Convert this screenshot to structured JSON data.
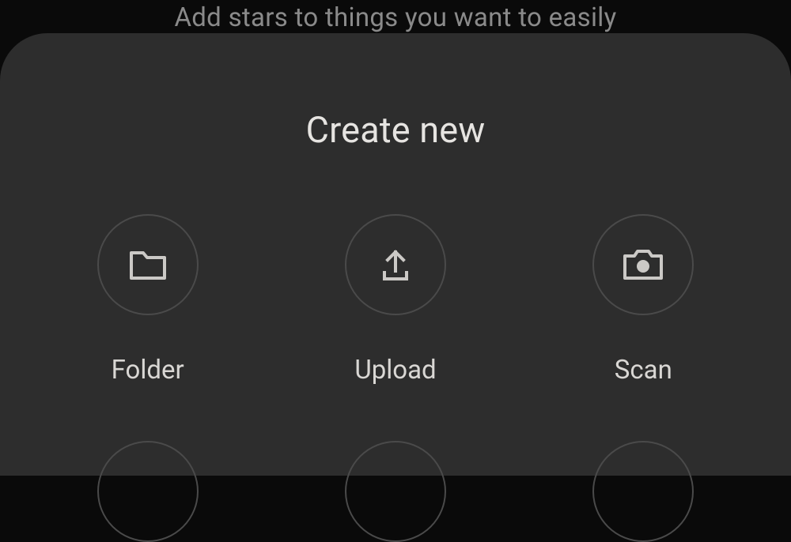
{
  "backdrop": {
    "hint_line": "Add stars to things you want to easily"
  },
  "sheet": {
    "title": "Create new",
    "actions": [
      {
        "label": "Folder",
        "icon": "folder-icon"
      },
      {
        "label": "Upload",
        "icon": "upload-icon"
      },
      {
        "label": "Scan",
        "icon": "camera-icon"
      }
    ]
  },
  "colors": {
    "sheet_bg": "#2d2d2d",
    "icon_stroke": "#cbc9c6",
    "circle_border": "#4a4a4a",
    "text_primary": "#e6e4e1",
    "text_secondary": "#d9d7d4",
    "backdrop_text": "#8a8a8a"
  }
}
